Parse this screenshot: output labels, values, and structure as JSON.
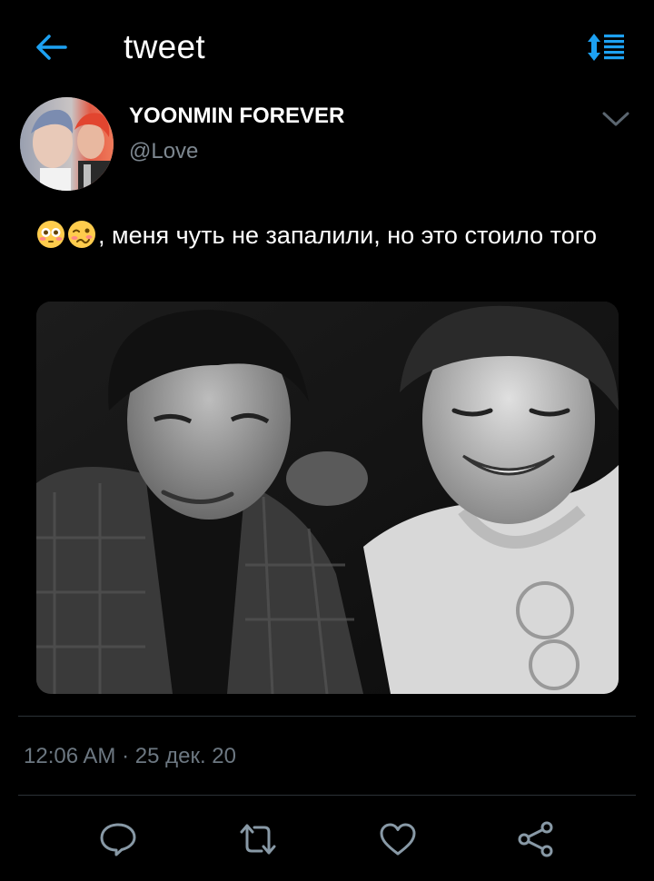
{
  "header": {
    "title": "tweet",
    "back_icon": "arrow-left-icon",
    "sort_icon": "sort-lines-icon",
    "accent_color": "#1da1f2"
  },
  "tweet": {
    "author": {
      "display_name": "YOONMIN FOREVER",
      "handle": "@Love",
      "avatar_icon": "avatar-photo"
    },
    "emojis": [
      "flushed-face-icon",
      "woozy-face-icon"
    ],
    "text": ", меня чуть не запалили, но это стоило того",
    "media": {
      "kind": "black-and-white photo of two smiling people"
    },
    "timestamp": "12:06 AM · 25 дек. 20"
  },
  "actions": [
    {
      "name": "reply",
      "icon": "reply-bubble-icon"
    },
    {
      "name": "retweet",
      "icon": "retweet-icon"
    },
    {
      "name": "like",
      "icon": "heart-icon"
    },
    {
      "name": "share",
      "icon": "share-icon"
    }
  ],
  "colors": {
    "background": "#000000",
    "secondary_text": "#7d8790",
    "icon_gray": "#8899a6",
    "divider": "#2c3237"
  }
}
